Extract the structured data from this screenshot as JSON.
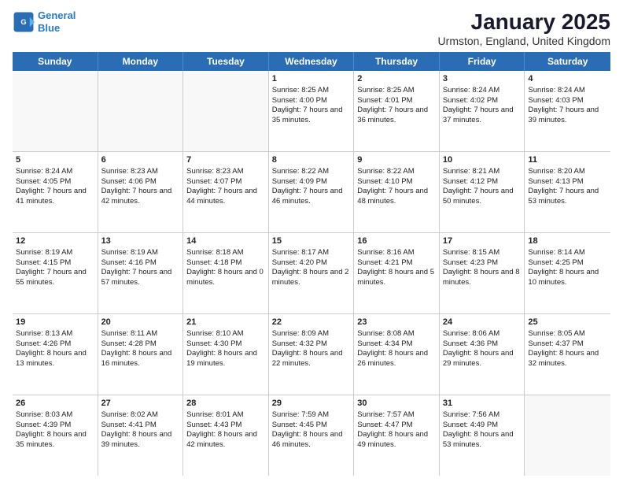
{
  "logo": {
    "line1": "General",
    "line2": "Blue"
  },
  "title": "January 2025",
  "subtitle": "Urmston, England, United Kingdom",
  "days": [
    "Sunday",
    "Monday",
    "Tuesday",
    "Wednesday",
    "Thursday",
    "Friday",
    "Saturday"
  ],
  "rows": [
    [
      {
        "day": "",
        "data": "",
        "empty": true
      },
      {
        "day": "",
        "data": "",
        "empty": true
      },
      {
        "day": "",
        "data": "",
        "empty": true
      },
      {
        "day": "1",
        "data": "Sunrise: 8:25 AM\nSunset: 4:00 PM\nDaylight: 7 hours and 35 minutes.",
        "empty": false
      },
      {
        "day": "2",
        "data": "Sunrise: 8:25 AM\nSunset: 4:01 PM\nDaylight: 7 hours and 36 minutes.",
        "empty": false
      },
      {
        "day": "3",
        "data": "Sunrise: 8:24 AM\nSunset: 4:02 PM\nDaylight: 7 hours and 37 minutes.",
        "empty": false
      },
      {
        "day": "4",
        "data": "Sunrise: 8:24 AM\nSunset: 4:03 PM\nDaylight: 7 hours and 39 minutes.",
        "empty": false
      }
    ],
    [
      {
        "day": "5",
        "data": "Sunrise: 8:24 AM\nSunset: 4:05 PM\nDaylight: 7 hours and 41 minutes.",
        "empty": false
      },
      {
        "day": "6",
        "data": "Sunrise: 8:23 AM\nSunset: 4:06 PM\nDaylight: 7 hours and 42 minutes.",
        "empty": false
      },
      {
        "day": "7",
        "data": "Sunrise: 8:23 AM\nSunset: 4:07 PM\nDaylight: 7 hours and 44 minutes.",
        "empty": false
      },
      {
        "day": "8",
        "data": "Sunrise: 8:22 AM\nSunset: 4:09 PM\nDaylight: 7 hours and 46 minutes.",
        "empty": false
      },
      {
        "day": "9",
        "data": "Sunrise: 8:22 AM\nSunset: 4:10 PM\nDaylight: 7 hours and 48 minutes.",
        "empty": false
      },
      {
        "day": "10",
        "data": "Sunrise: 8:21 AM\nSunset: 4:12 PM\nDaylight: 7 hours and 50 minutes.",
        "empty": false
      },
      {
        "day": "11",
        "data": "Sunrise: 8:20 AM\nSunset: 4:13 PM\nDaylight: 7 hours and 53 minutes.",
        "empty": false
      }
    ],
    [
      {
        "day": "12",
        "data": "Sunrise: 8:19 AM\nSunset: 4:15 PM\nDaylight: 7 hours and 55 minutes.",
        "empty": false
      },
      {
        "day": "13",
        "data": "Sunrise: 8:19 AM\nSunset: 4:16 PM\nDaylight: 7 hours and 57 minutes.",
        "empty": false
      },
      {
        "day": "14",
        "data": "Sunrise: 8:18 AM\nSunset: 4:18 PM\nDaylight: 8 hours and 0 minutes.",
        "empty": false
      },
      {
        "day": "15",
        "data": "Sunrise: 8:17 AM\nSunset: 4:20 PM\nDaylight: 8 hours and 2 minutes.",
        "empty": false
      },
      {
        "day": "16",
        "data": "Sunrise: 8:16 AM\nSunset: 4:21 PM\nDaylight: 8 hours and 5 minutes.",
        "empty": false
      },
      {
        "day": "17",
        "data": "Sunrise: 8:15 AM\nSunset: 4:23 PM\nDaylight: 8 hours and 8 minutes.",
        "empty": false
      },
      {
        "day": "18",
        "data": "Sunrise: 8:14 AM\nSunset: 4:25 PM\nDaylight: 8 hours and 10 minutes.",
        "empty": false
      }
    ],
    [
      {
        "day": "19",
        "data": "Sunrise: 8:13 AM\nSunset: 4:26 PM\nDaylight: 8 hours and 13 minutes.",
        "empty": false
      },
      {
        "day": "20",
        "data": "Sunrise: 8:11 AM\nSunset: 4:28 PM\nDaylight: 8 hours and 16 minutes.",
        "empty": false
      },
      {
        "day": "21",
        "data": "Sunrise: 8:10 AM\nSunset: 4:30 PM\nDaylight: 8 hours and 19 minutes.",
        "empty": false
      },
      {
        "day": "22",
        "data": "Sunrise: 8:09 AM\nSunset: 4:32 PM\nDaylight: 8 hours and 22 minutes.",
        "empty": false
      },
      {
        "day": "23",
        "data": "Sunrise: 8:08 AM\nSunset: 4:34 PM\nDaylight: 8 hours and 26 minutes.",
        "empty": false
      },
      {
        "day": "24",
        "data": "Sunrise: 8:06 AM\nSunset: 4:36 PM\nDaylight: 8 hours and 29 minutes.",
        "empty": false
      },
      {
        "day": "25",
        "data": "Sunrise: 8:05 AM\nSunset: 4:37 PM\nDaylight: 8 hours and 32 minutes.",
        "empty": false
      }
    ],
    [
      {
        "day": "26",
        "data": "Sunrise: 8:03 AM\nSunset: 4:39 PM\nDaylight: 8 hours and 35 minutes.",
        "empty": false
      },
      {
        "day": "27",
        "data": "Sunrise: 8:02 AM\nSunset: 4:41 PM\nDaylight: 8 hours and 39 minutes.",
        "empty": false
      },
      {
        "day": "28",
        "data": "Sunrise: 8:01 AM\nSunset: 4:43 PM\nDaylight: 8 hours and 42 minutes.",
        "empty": false
      },
      {
        "day": "29",
        "data": "Sunrise: 7:59 AM\nSunset: 4:45 PM\nDaylight: 8 hours and 46 minutes.",
        "empty": false
      },
      {
        "day": "30",
        "data": "Sunrise: 7:57 AM\nSunset: 4:47 PM\nDaylight: 8 hours and 49 minutes.",
        "empty": false
      },
      {
        "day": "31",
        "data": "Sunrise: 7:56 AM\nSunset: 4:49 PM\nDaylight: 8 hours and 53 minutes.",
        "empty": false
      },
      {
        "day": "",
        "data": "",
        "empty": true
      }
    ]
  ]
}
